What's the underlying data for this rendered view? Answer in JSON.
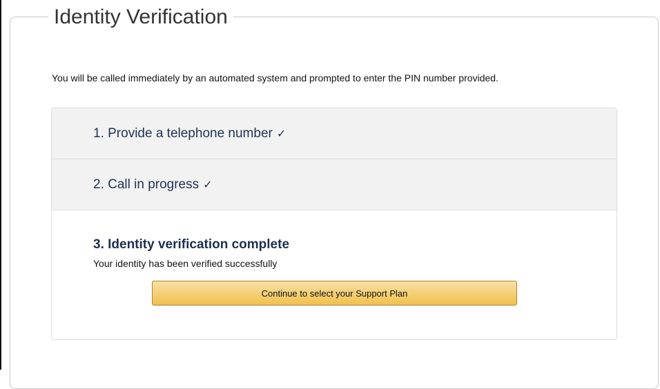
{
  "panel": {
    "title": "Identity Verification",
    "intro": "You will be called immediately by an automated system and prompted to enter the PIN number provided."
  },
  "steps": [
    {
      "label": "1. Provide a telephone number",
      "check": "✓"
    },
    {
      "label": "2. Call in progress",
      "check": "✓"
    },
    {
      "label": "3. Identity verification complete",
      "message": "Your identity has been verified successfully"
    }
  ],
  "actions": {
    "continue_label": "Continue to select your Support Plan"
  },
  "colors": {
    "button_top": "#f7dfa5",
    "button_bottom": "#f0c14b",
    "heading": "#1f2f4f"
  }
}
